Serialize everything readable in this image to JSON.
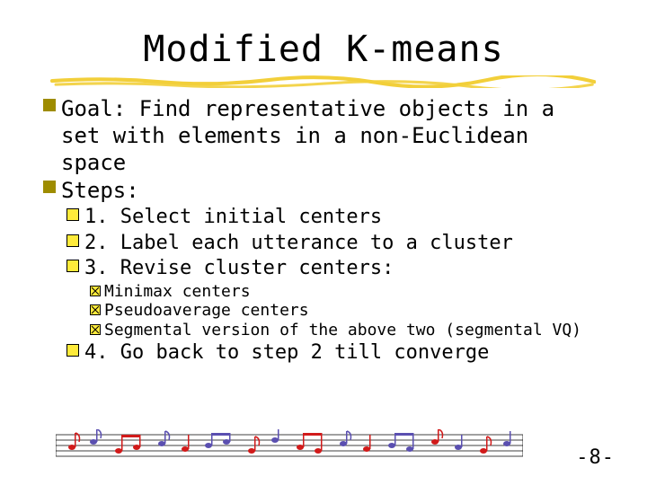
{
  "title": "Modified K-means",
  "bullets": {
    "goal": "Goal: Find representative objects in a set with elements in a non-Euclidean space",
    "steps_label": "Steps:",
    "steps": [
      "1. Select initial centers",
      "2. Label each utterance to a cluster",
      "3. Revise cluster centers:"
    ],
    "substeps": [
      "Minimax centers",
      "Pseudoaverage centers",
      "Segmental version of the above two (segmental VQ)"
    ],
    "final_step": "4. Go back to step 2 till converge"
  },
  "page_number": "-8-",
  "colors": {
    "underline": "#f2cf3a",
    "bullet_lvl1": "#9e8c00",
    "bullet_lvl2_fill": "#ffeb3b",
    "bullet_lvl3_fill": "#ffeb3b",
    "note_red": "#d11a1a",
    "note_purple": "#5a4fb0"
  }
}
